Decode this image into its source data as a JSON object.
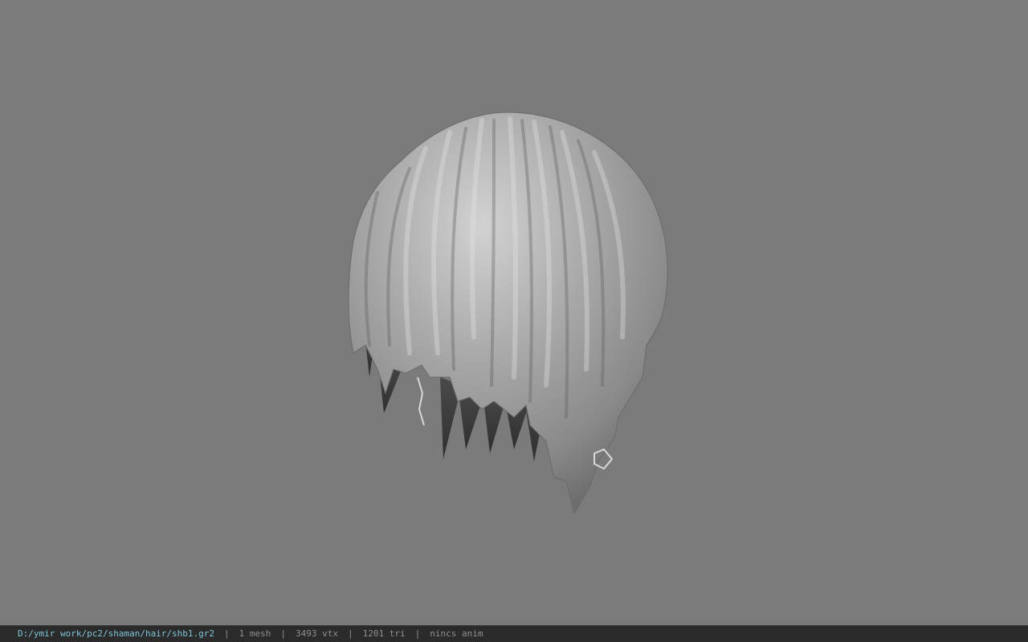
{
  "viewport": {
    "background_color": "#7b7b7b",
    "model": "hair-mesh"
  },
  "statusbar": {
    "path": "D:/ymir work/pc2/shaman/hair/shb1.gr2",
    "separator": "|",
    "mesh": "1 mesh",
    "vtx": "3493 vtx",
    "tri": "1201 tri",
    "anim": "nincs anim",
    "path_color": "#7fc4d6"
  }
}
